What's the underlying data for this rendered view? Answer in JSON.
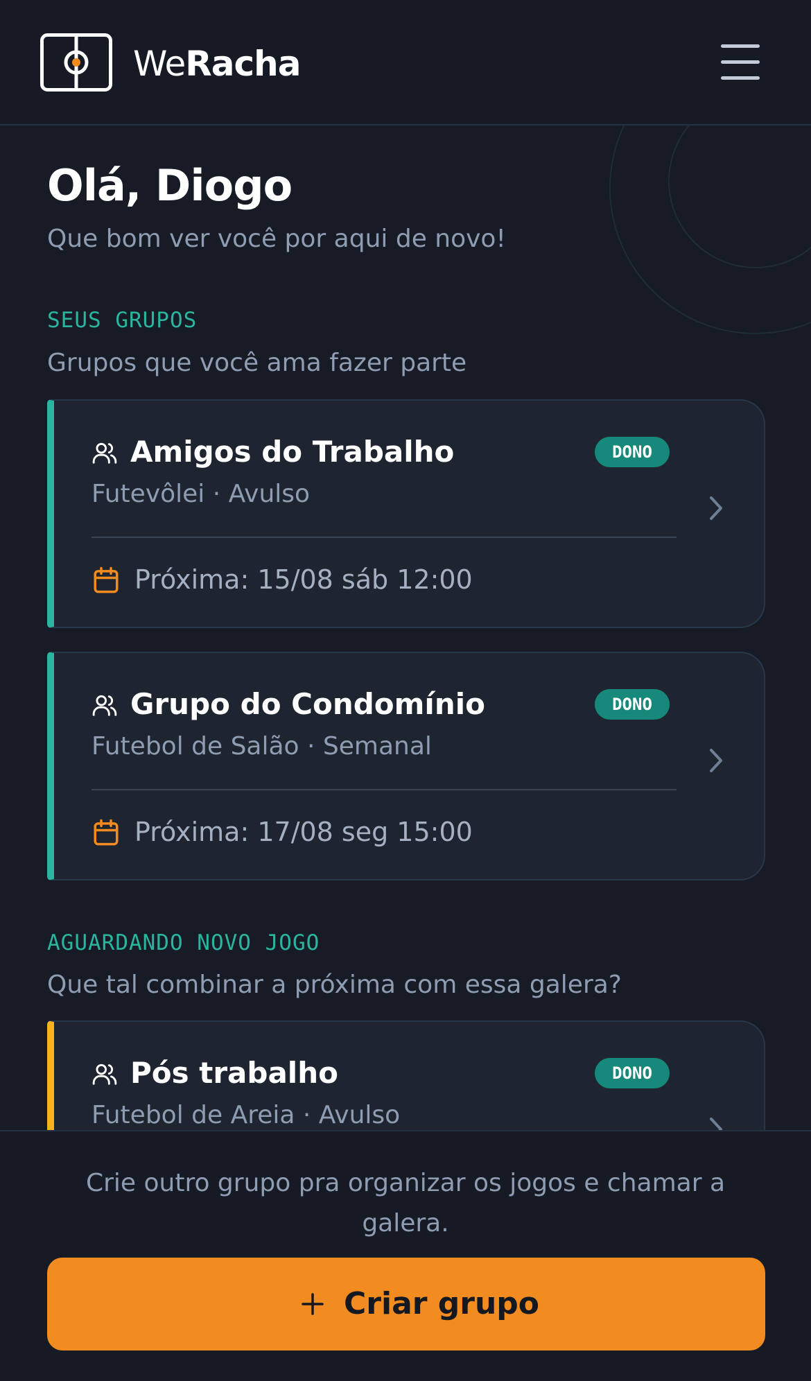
{
  "header": {
    "brand_prefix": "We",
    "brand_strong": "Racha",
    "logo_icon": "soccer-field-icon",
    "menu_icon": "hamburger-menu-icon"
  },
  "greeting": {
    "title": "Olá, Diogo",
    "subtitle": "Que bom ver você por aqui de novo!"
  },
  "my_groups": {
    "label": "SEUS GRUPOS",
    "description": "Grupos que você ama fazer parte",
    "groups": [
      {
        "name": "Amigos do Trabalho",
        "badge": "DONO",
        "meta": "Futevôlei · Avulso",
        "next": "Próxima: 15/08 sáb 12:00"
      },
      {
        "name": "Grupo do Condomínio",
        "badge": "DONO",
        "meta": "Futebol de Salão · Semanal",
        "next": "Próxima: 17/08 seg 15:00"
      }
    ]
  },
  "awaiting": {
    "label": "AGUARDANDO NOVO JOGO",
    "description": "Que tal combinar a próxima com essa galera?",
    "groups": [
      {
        "name": "Pós trabalho",
        "badge": "DONO",
        "meta": "Futebol de Areia · Avulso"
      }
    ]
  },
  "bottom": {
    "text": "Crie outro grupo pra organizar os jogos e chamar a galera.",
    "button_label": "Criar grupo"
  },
  "colors": {
    "background": "#161b25",
    "accent_teal": "#2bb49e",
    "accent_orange": "#f28b20",
    "pending_yellow": "#f5b417",
    "badge_bg": "#16897a"
  }
}
